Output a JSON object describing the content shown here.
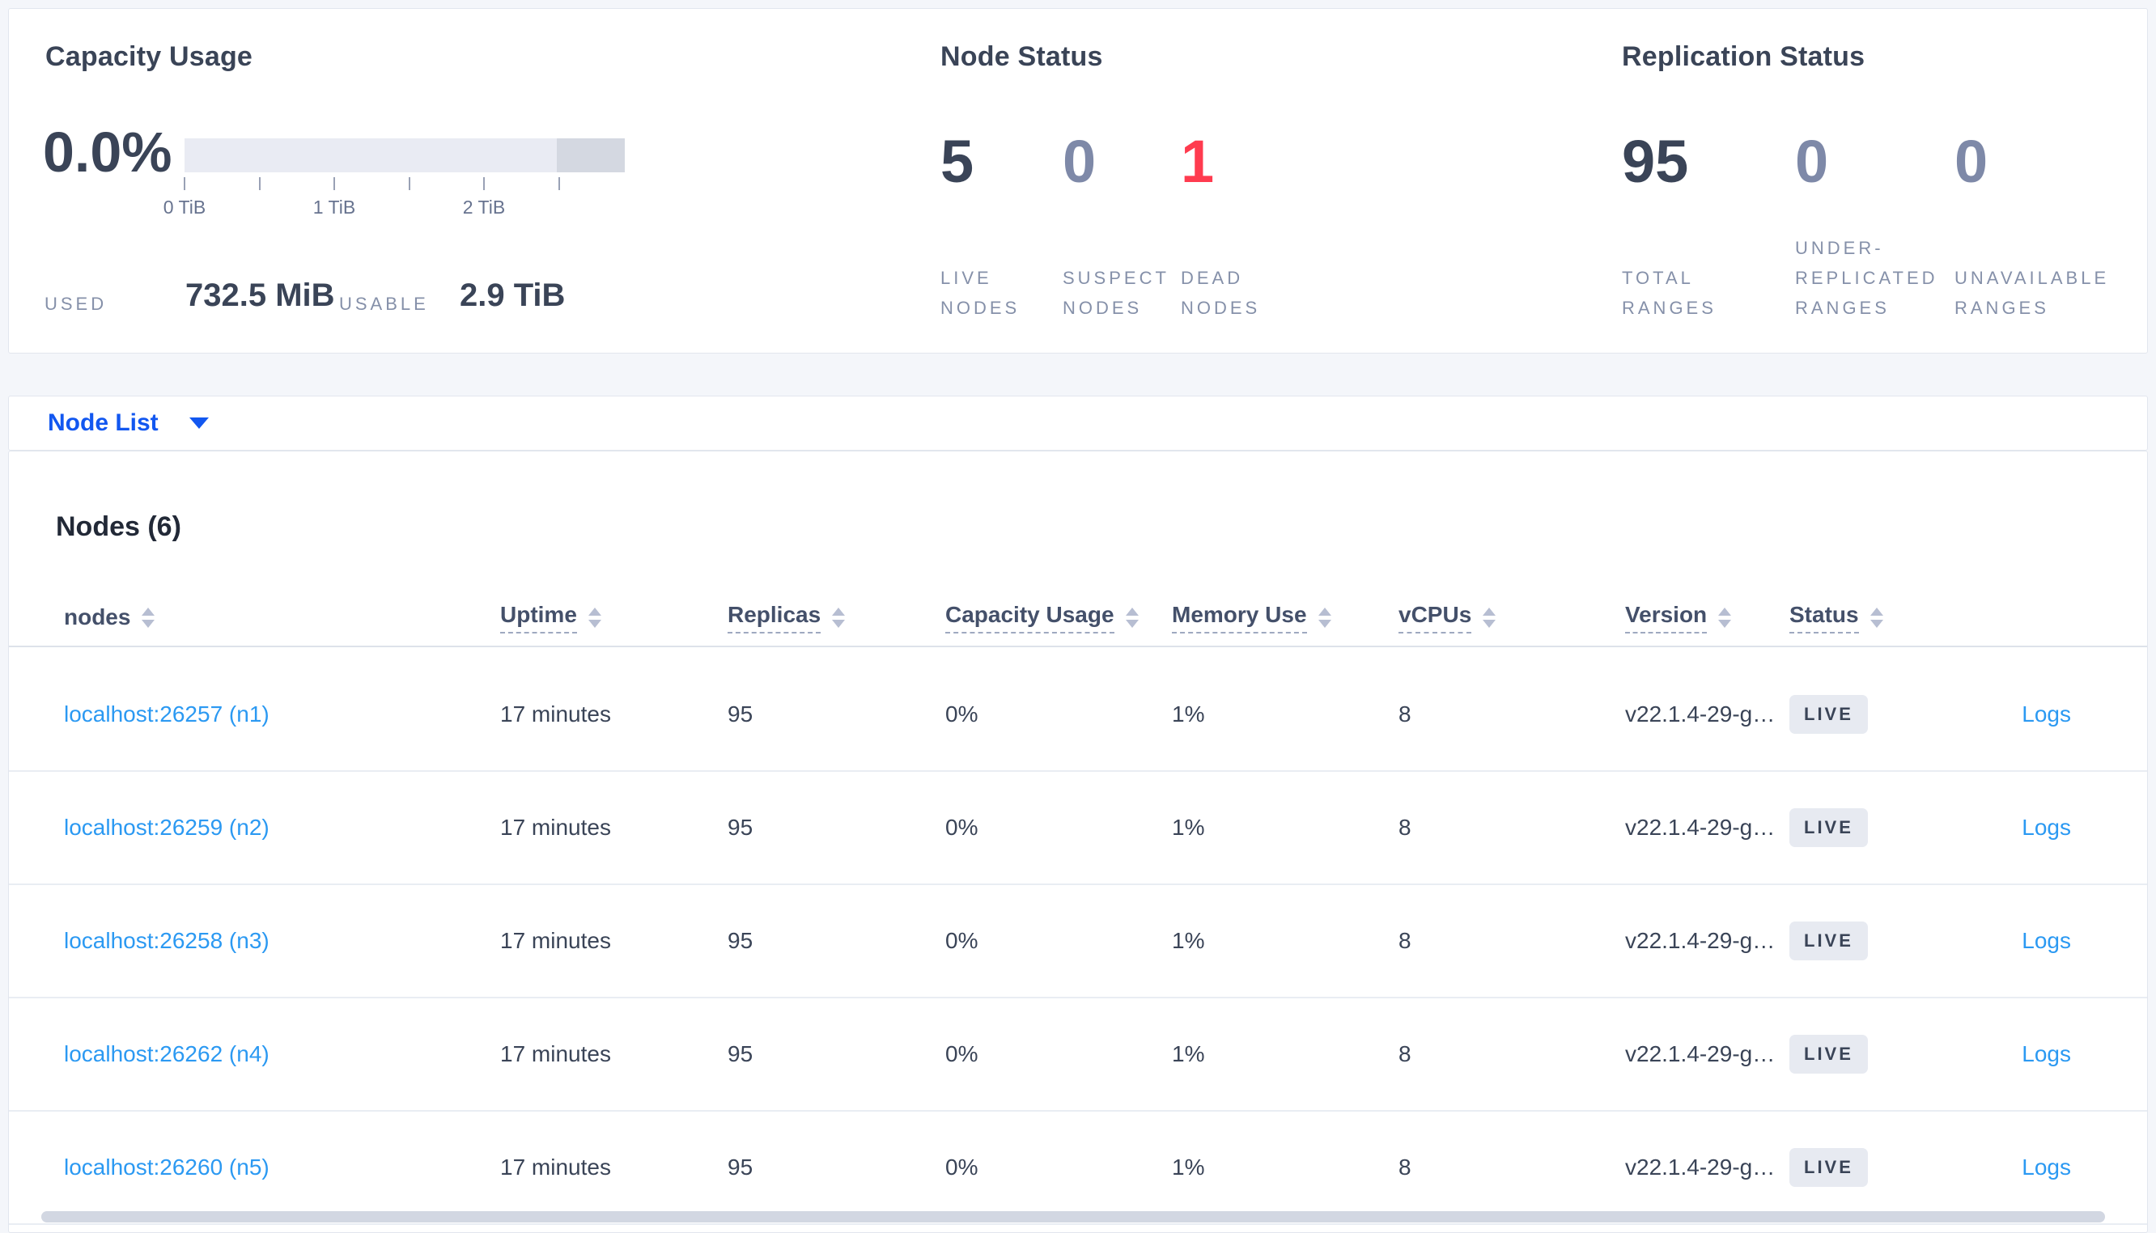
{
  "capacity": {
    "title": "Capacity Usage",
    "percent": "0.0%",
    "ticks": [
      "0 TiB",
      "1 TiB",
      "2 TiB"
    ],
    "used_label": "USED",
    "used_value": "732.5 MiB",
    "usable_label": "USABLE",
    "usable_value": "2.9 TiB"
  },
  "node_status": {
    "title": "Node Status",
    "stats": [
      {
        "value": "5",
        "label": "LIVE\nNODES",
        "color": "#3a4457"
      },
      {
        "value": "0",
        "label": "SUSPECT\nNODES",
        "color": "#7e89a8"
      },
      {
        "value": "1",
        "label": "DEAD\nNODES",
        "color": "#ff3b4f"
      }
    ]
  },
  "replication_status": {
    "title": "Replication Status",
    "stats": [
      {
        "value": "95",
        "label": "TOTAL\nRANGES",
        "color": "#3a4457"
      },
      {
        "value": "0",
        "label": "UNDER-\nREPLICATED\nRANGES",
        "color": "#7e89a8"
      },
      {
        "value": "0",
        "label": "UNAVAILABLE\nRANGES",
        "color": "#7e89a8"
      }
    ]
  },
  "view_selector": {
    "label": "Node List",
    "icon": "caret-down-icon"
  },
  "nodes_section": {
    "title": "Nodes (6)",
    "columns": [
      {
        "label": "nodes",
        "sortable": true,
        "underlined": false
      },
      {
        "label": "Uptime",
        "sortable": true,
        "underlined": true
      },
      {
        "label": "Replicas",
        "sortable": true,
        "underlined": true
      },
      {
        "label": "Capacity Usage",
        "sortable": true,
        "underlined": true
      },
      {
        "label": "Memory Use",
        "sortable": true,
        "underlined": true
      },
      {
        "label": "vCPUs",
        "sortable": true,
        "underlined": true
      },
      {
        "label": "Version",
        "sortable": true,
        "underlined": true
      },
      {
        "label": "Status",
        "sortable": true,
        "underlined": true
      }
    ],
    "rows": [
      {
        "node": "localhost:26257 (n1)",
        "uptime": "17 minutes",
        "replicas": "95",
        "capacity_usage": "0%",
        "memory_use": "1%",
        "vcpus": "8",
        "version": "v22.1.4-29-g…",
        "status": "LIVE",
        "logs": "Logs"
      },
      {
        "node": "localhost:26259 (n2)",
        "uptime": "17 minutes",
        "replicas": "95",
        "capacity_usage": "0%",
        "memory_use": "1%",
        "vcpus": "8",
        "version": "v22.1.4-29-g…",
        "status": "LIVE",
        "logs": "Logs"
      },
      {
        "node": "localhost:26258 (n3)",
        "uptime": "17 minutes",
        "replicas": "95",
        "capacity_usage": "0%",
        "memory_use": "1%",
        "vcpus": "8",
        "version": "v22.1.4-29-g…",
        "status": "LIVE",
        "logs": "Logs"
      },
      {
        "node": "localhost:26262 (n4)",
        "uptime": "17 minutes",
        "replicas": "95",
        "capacity_usage": "0%",
        "memory_use": "1%",
        "vcpus": "8",
        "version": "v22.1.4-29-g…",
        "status": "LIVE",
        "logs": "Logs"
      },
      {
        "node": "localhost:26260 (n5)",
        "uptime": "17 minutes",
        "replicas": "95",
        "capacity_usage": "0%",
        "memory_use": "1%",
        "vcpus": "8",
        "version": "v22.1.4-29-g…",
        "status": "LIVE",
        "logs": "Logs"
      }
    ]
  },
  "colors": {
    "accent_blue": "#1257f0",
    "link_blue": "#2b99f2",
    "dead_red": "#ff3b4f",
    "muted_stat": "#7e89a8",
    "bar_track": "#e9ebf3",
    "bar_end_segment": "#d4d8e1",
    "badge_bg": "#e7eaf1"
  }
}
